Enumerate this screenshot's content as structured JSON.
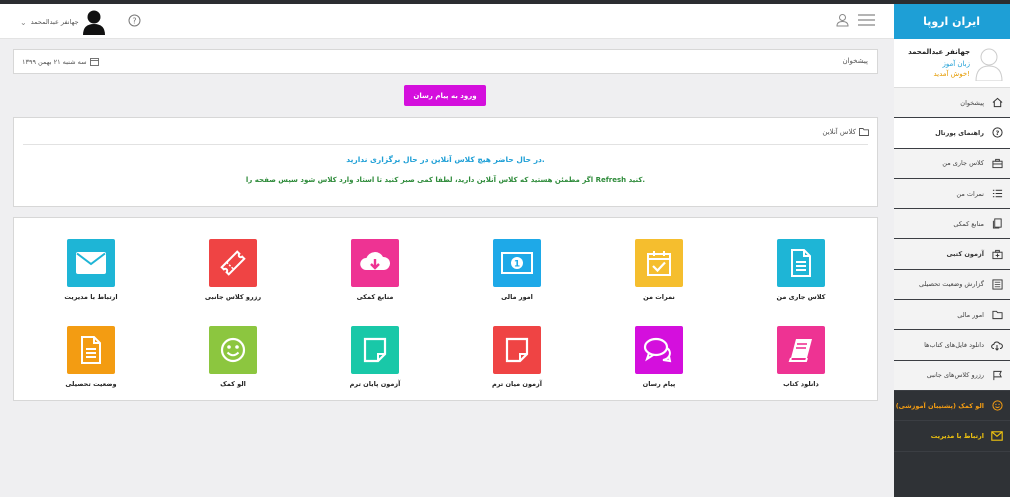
{
  "brand": {
    "title": "ایران اروپا",
    "color": "#1e9fd6"
  },
  "profile": {
    "name": "جهانفر عبدالمحمد",
    "role": "زبان آموز",
    "welcome": "خوش آمدید!"
  },
  "sidebar": {
    "items": [
      {
        "label": "پیشخوان",
        "icon": "home-icon"
      },
      {
        "label": "راهنمای پورتال",
        "icon": "help-circle-icon"
      },
      {
        "label": "کلاس جاری من",
        "icon": "briefcase-icon"
      },
      {
        "label": "نمرات من",
        "icon": "list-icon"
      },
      {
        "label": "منابع کمکی",
        "icon": "files-icon"
      },
      {
        "label": "آزمون کتبی",
        "icon": "exam-briefcase-icon"
      },
      {
        "label": "گزارش وضعیت تحصیلی",
        "icon": "report-book-icon"
      },
      {
        "label": "امور مالی",
        "icon": "folder-icon"
      },
      {
        "label": "دانلود فایل‌های کتاب‌ها",
        "icon": "cloud-download-icon"
      },
      {
        "label": "رزرو کلاس‌های جانبی",
        "icon": "reserve-icon"
      },
      {
        "label": "الو کمک (پشتیبان آموزشی)",
        "icon": "smile-icon"
      },
      {
        "label": "ارتباط با مدیریت",
        "icon": "mail-icon"
      }
    ]
  },
  "topbar": {
    "username": "جهانفر عبدالمحمد"
  },
  "breadcrumb": {
    "title": "پیشخوان",
    "date": "سه شنبه ۲۱ بهمن ۱۳۹۹"
  },
  "message_button": {
    "label": "ورود به پیام رسان",
    "color": "#d40fdd"
  },
  "online": {
    "title": "کلاس آنلاین",
    "none": "در حال حاضر هیچ کلاس آنلاین در حال برگزاری ندارید.",
    "hint": "اگر مطمئن هستید که کلاس آنلاین دارید، لطفا کمی صبر کنید تا استاد وارد کلاس شود سپس صفحه را Refresh کنید."
  },
  "tiles": [
    {
      "label": "کلاس جاری من",
      "color": "#1eb5d6",
      "icon": "document-icon"
    },
    {
      "label": "نمرات من",
      "color": "#f5be2e",
      "icon": "calendar-check-icon"
    },
    {
      "label": "امور مالی",
      "color": "#1ea9e8",
      "icon": "money-icon"
    },
    {
      "label": "منابع کمکی",
      "color": "#ee3393",
      "icon": "cloud-download-icon"
    },
    {
      "label": "رزرو کلاس جانبی",
      "color": "#ef4444",
      "icon": "ticket-icon"
    },
    {
      "label": "ارتباط با مدیریت",
      "color": "#1eb5d6",
      "icon": "envelope-icon"
    },
    {
      "label": "دانلود کتاب",
      "color": "#ee3393",
      "icon": "book-icon"
    },
    {
      "label": "پیام رسان",
      "color": "#d40fdd",
      "icon": "chat-icon"
    },
    {
      "label": "آزمون میان ترم",
      "color": "#ef4444",
      "icon": "paper-icon"
    },
    {
      "label": "آزمون پایان ترم",
      "color": "#19c8a8",
      "icon": "paper-icon"
    },
    {
      "label": "الو کمک",
      "color": "#8cc63f",
      "icon": "smile-icon"
    },
    {
      "label": "وضعیت تحصیلی",
      "color": "#f39c12",
      "icon": "document-icon"
    }
  ]
}
